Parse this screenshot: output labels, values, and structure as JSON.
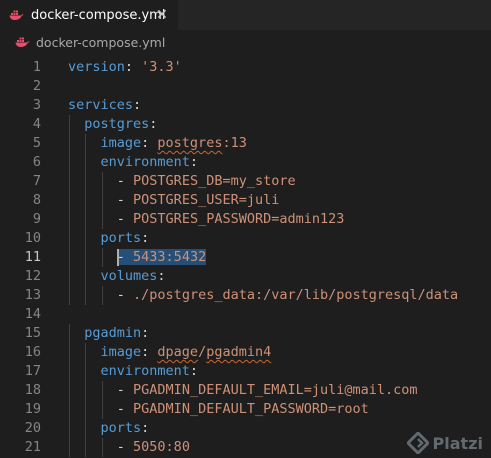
{
  "tab": {
    "title": "docker-compose.yml",
    "close_glyph": "✕",
    "icon": "docker-whale-icon",
    "icon_color": "#e2506b"
  },
  "breadcrumb": {
    "file": "docker-compose.yml",
    "icon": "docker-whale-icon"
  },
  "editor": {
    "active_line": 11,
    "lines": [
      {
        "n": "1",
        "tokens": [
          {
            "c": "k",
            "t": "version"
          },
          {
            "c": "p",
            "t": ": "
          },
          {
            "c": "s",
            "t": "'3.3'"
          }
        ]
      },
      {
        "n": "2",
        "tokens": []
      },
      {
        "n": "3",
        "tokens": [
          {
            "c": "k",
            "t": "services"
          },
          {
            "c": "p",
            "t": ":"
          }
        ]
      },
      {
        "n": "4",
        "tokens": [
          {
            "c": "p",
            "t": "  "
          },
          {
            "c": "k",
            "t": "postgres"
          },
          {
            "c": "p",
            "t": ":"
          }
        ]
      },
      {
        "n": "5",
        "tokens": [
          {
            "c": "p",
            "t": "    "
          },
          {
            "c": "k",
            "t": "image"
          },
          {
            "c": "p",
            "t": ": "
          },
          {
            "c": "s squig",
            "t": "postgres"
          },
          {
            "c": "s",
            "t": ":13"
          }
        ]
      },
      {
        "n": "6",
        "tokens": [
          {
            "c": "p",
            "t": "    "
          },
          {
            "c": "k",
            "t": "environment"
          },
          {
            "c": "p",
            "t": ":"
          }
        ]
      },
      {
        "n": "7",
        "tokens": [
          {
            "c": "p",
            "t": "      "
          },
          {
            "c": "p",
            "t": "- "
          },
          {
            "c": "s",
            "t": "POSTGRES_DB=my_store"
          }
        ]
      },
      {
        "n": "8",
        "tokens": [
          {
            "c": "p",
            "t": "      "
          },
          {
            "c": "p",
            "t": "- "
          },
          {
            "c": "s",
            "t": "POSTGRES_USER=juli"
          }
        ]
      },
      {
        "n": "9",
        "tokens": [
          {
            "c": "p",
            "t": "      "
          },
          {
            "c": "p",
            "t": "- "
          },
          {
            "c": "s",
            "t": "POSTGRES_PASSWORD=admin123"
          }
        ]
      },
      {
        "n": "10",
        "tokens": [
          {
            "c": "p",
            "t": "    "
          },
          {
            "c": "k",
            "t": "ports"
          },
          {
            "c": "p",
            "t": ":"
          }
        ]
      },
      {
        "n": "11",
        "tokens": [
          {
            "c": "p",
            "t": "      "
          },
          {
            "c": "p sel",
            "t": "- "
          },
          {
            "c": "s sel",
            "t": "5433:5432"
          }
        ]
      },
      {
        "n": "12",
        "tokens": [
          {
            "c": "p",
            "t": "    "
          },
          {
            "c": "k",
            "t": "volumes"
          },
          {
            "c": "p",
            "t": ":"
          }
        ]
      },
      {
        "n": "13",
        "tokens": [
          {
            "c": "p",
            "t": "      "
          },
          {
            "c": "p",
            "t": "- "
          },
          {
            "c": "s",
            "t": "./postgres_data:/var/lib/postgresql/data"
          }
        ]
      },
      {
        "n": "14",
        "tokens": []
      },
      {
        "n": "15",
        "tokens": [
          {
            "c": "p",
            "t": "  "
          },
          {
            "c": "k",
            "t": "pgadmin"
          },
          {
            "c": "p",
            "t": ":"
          }
        ]
      },
      {
        "n": "16",
        "tokens": [
          {
            "c": "p",
            "t": "    "
          },
          {
            "c": "k",
            "t": "image"
          },
          {
            "c": "p",
            "t": ": "
          },
          {
            "c": "s squig",
            "t": "dpage"
          },
          {
            "c": "s",
            "t": "/"
          },
          {
            "c": "s squig",
            "t": "pgadmin4"
          }
        ]
      },
      {
        "n": "17",
        "tokens": [
          {
            "c": "p",
            "t": "    "
          },
          {
            "c": "k",
            "t": "environment"
          },
          {
            "c": "p",
            "t": ":"
          }
        ]
      },
      {
        "n": "18",
        "tokens": [
          {
            "c": "p",
            "t": "      "
          },
          {
            "c": "p",
            "t": "- "
          },
          {
            "c": "s",
            "t": "PGADMIN_DEFAULT_EMAIL=juli@mail.com"
          }
        ]
      },
      {
        "n": "19",
        "tokens": [
          {
            "c": "p",
            "t": "      "
          },
          {
            "c": "p",
            "t": "- "
          },
          {
            "c": "s",
            "t": "PGADMIN_DEFAULT_PASSWORD=root"
          }
        ]
      },
      {
        "n": "20",
        "tokens": [
          {
            "c": "p",
            "t": "    "
          },
          {
            "c": "k",
            "t": "ports"
          },
          {
            "c": "p",
            "t": ":"
          }
        ]
      },
      {
        "n": "21",
        "tokens": [
          {
            "c": "p",
            "t": "      "
          },
          {
            "c": "p",
            "t": "- "
          },
          {
            "c": "s",
            "t": "5050:80"
          }
        ]
      }
    ]
  },
  "watermark": {
    "text": "Platzi",
    "icon": "platzi-logo-icon"
  }
}
